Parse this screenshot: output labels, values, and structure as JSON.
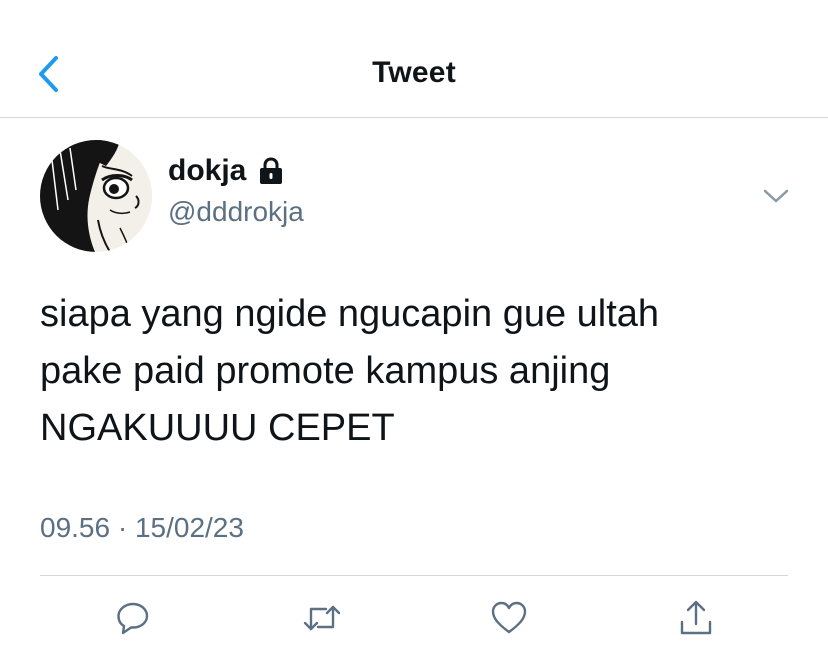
{
  "header": {
    "title": "Tweet",
    "back_icon": "chevron-left-icon"
  },
  "author": {
    "display_name": "dokja",
    "handle": "@dddrokja",
    "protected_icon": "lock-icon"
  },
  "tweet": {
    "lines": [
      "siapa yang ngide ngucapin gue ultah",
      "pake paid promote kampus anjing",
      "NGAKUUUU CEPET"
    ],
    "timestamp": "09.56 · 15/02/23"
  },
  "actions": [
    "reply-icon",
    "retweet-icon",
    "like-icon",
    "share-icon"
  ],
  "colors": {
    "accent": "#1d9bf0",
    "text_primary": "#0f1419",
    "text_secondary": "#5b7083",
    "divider": "#d4d8dc"
  }
}
